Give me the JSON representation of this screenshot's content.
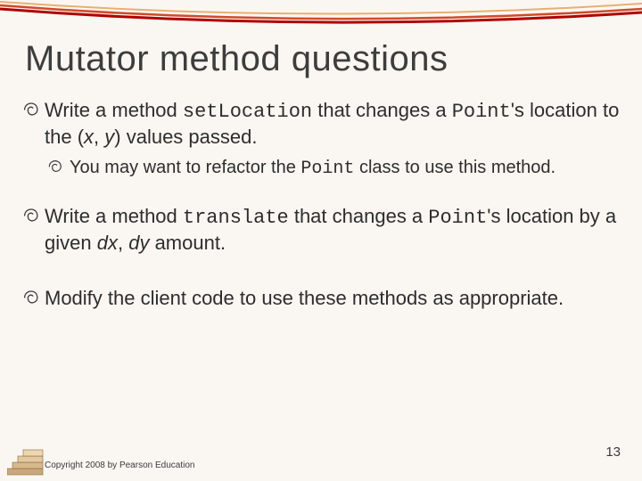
{
  "title": "Mutator method questions",
  "bullets": {
    "b0": {
      "t0": "Write a method ",
      "code0": "setLocation",
      "t1": " that changes a ",
      "code1": "Point",
      "t2": "'s location to the (",
      "x": "x",
      "comma": ", ",
      "y": "y",
      "t3": ") values passed."
    },
    "sub0": {
      "t0": "You may want to refactor the ",
      "code0": "Point",
      "t1": " class to use this method."
    },
    "b1": {
      "t0": "Write a method ",
      "code0": "translate",
      "t1": " that changes a ",
      "code1": "Point",
      "t2": "'s location by a given ",
      "dx": "dx",
      "comma": ", ",
      "dy": "dy",
      "t3": " amount."
    },
    "b2": {
      "t0": "Modify the client code to use these methods as appropriate."
    }
  },
  "footer": "Copyright 2008 by Pearson Education",
  "page_number": "13",
  "colors": {
    "accent": "#b00000",
    "accent_mid": "#d14a2a",
    "accent_light": "#e8b070"
  }
}
